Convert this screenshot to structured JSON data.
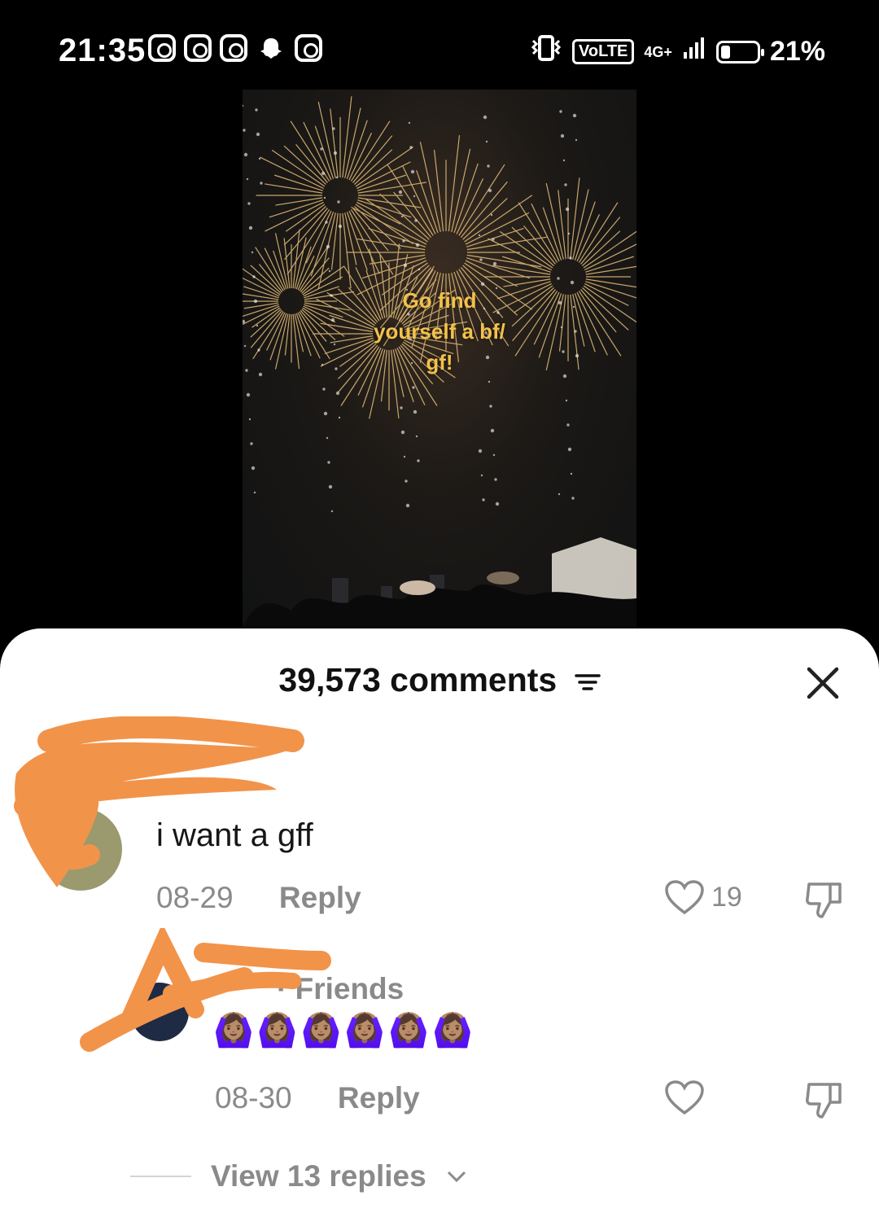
{
  "status_bar": {
    "time": "21:35",
    "network_volte": "VoLTE",
    "network_type": "4G+",
    "battery": "21%"
  },
  "video": {
    "overlay_text_lines": [
      "Go find",
      "yourself a bf/",
      "gf!"
    ]
  },
  "comments_sheet": {
    "title": "39,573 comments",
    "comments": [
      {
        "text": "i want a gff",
        "date": "08-29",
        "reply_label": "Reply",
        "likes": "19"
      },
      {
        "friends_label": "· Friends",
        "text": "🙆🏽‍♀️🙆🏽‍♀️🙆🏽‍♀️🙆🏽‍♀️🙆🏽‍♀️🙆🏽‍♀️",
        "date": "08-30",
        "reply_label": "Reply",
        "view_replies": "View 13 replies"
      }
    ]
  },
  "colors": {
    "accent_orange": "#F2934A",
    "overlay_yellow": "#F3C24A",
    "meta_gray": "#8A8A8A"
  },
  "icons": [
    "instagram-icon",
    "snapchat-icon",
    "vibrate-icon",
    "signal-icon",
    "battery-icon",
    "filter-icon",
    "close-icon",
    "heart-icon",
    "dislike-icon",
    "chevron-down-icon"
  ]
}
